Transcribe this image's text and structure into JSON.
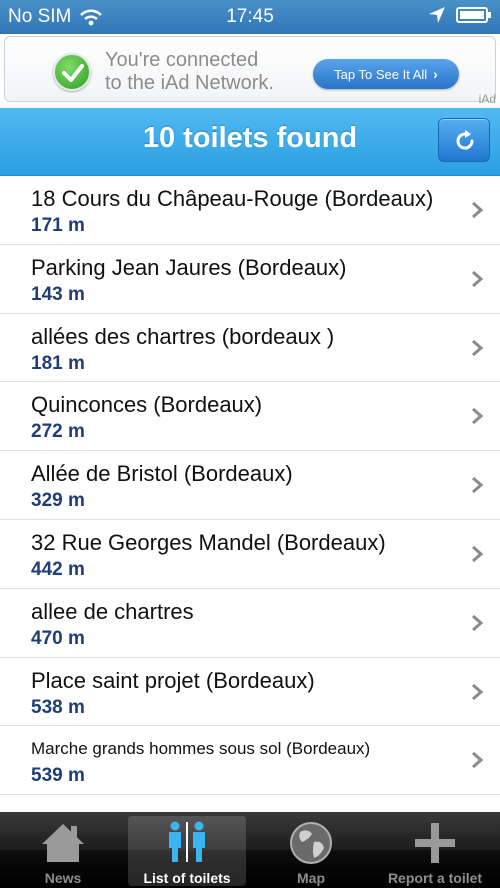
{
  "status": {
    "carrier": "No SIM",
    "time": "17:45"
  },
  "ad": {
    "line1": "You're connected",
    "line2": "to the iAd Network.",
    "cta": "Tap To See It All",
    "label": "iAd"
  },
  "header": {
    "title": "10 toilets found"
  },
  "toilets": [
    {
      "name": "18 Cours du Châpeau-Rouge (Bordeaux)",
      "distance": "171 m"
    },
    {
      "name": "Parking Jean Jaures (Bordeaux)",
      "distance": "143 m"
    },
    {
      "name": "allées des chartres  (bordeaux )",
      "distance": "181 m"
    },
    {
      "name": "Quinconces (Bordeaux)",
      "distance": "272 m"
    },
    {
      "name": "Allée de Bristol (Bordeaux)",
      "distance": "329 m"
    },
    {
      "name": "32 Rue Georges Mandel (Bordeaux)",
      "distance": "442 m"
    },
    {
      "name": "allee de chartres",
      "distance": "470 m"
    },
    {
      "name": "Place saint projet (Bordeaux)",
      "distance": "538 m"
    },
    {
      "name": "Marche grands hommes sous sol (Bordeaux)",
      "distance": "539 m"
    }
  ],
  "tabs": [
    {
      "label": "News",
      "icon": "house-icon",
      "selected": false
    },
    {
      "label": "List of toilets",
      "icon": "toilet-people-icon",
      "selected": true
    },
    {
      "label": "Map",
      "icon": "globe-icon",
      "selected": false
    },
    {
      "label": "Report a toilet",
      "icon": "plus-icon",
      "selected": false
    }
  ],
  "colors": {
    "header": "#2a9fe2",
    "distance": "#1f3e78",
    "status_bar": "#3a80bf"
  }
}
